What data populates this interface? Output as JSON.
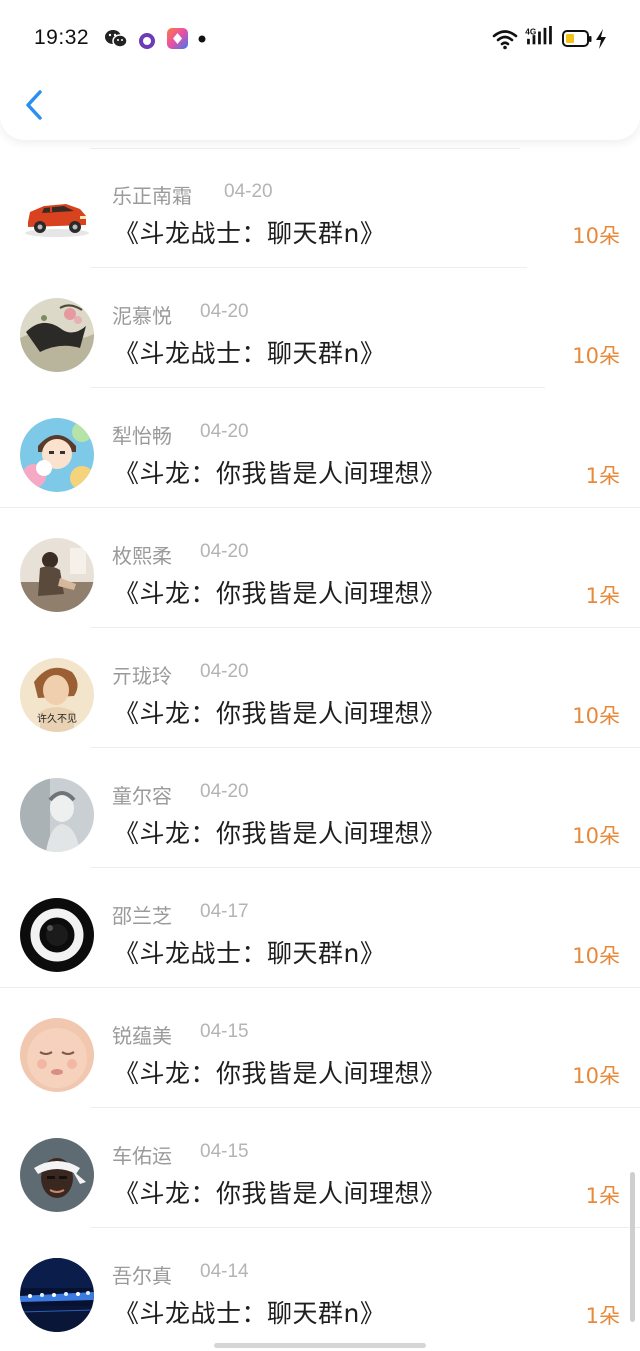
{
  "status_bar": {
    "time": "19:32",
    "network": "4G",
    "icons": [
      "wechat-icon",
      "dot-app-icon",
      "app-square-icon",
      "more-dot-icon",
      "wifi-icon",
      "signal-icon",
      "battery-icon",
      "charge-icon"
    ]
  },
  "nav": {
    "back_icon": "chevron-left-icon"
  },
  "colors": {
    "accent": "#e8883a",
    "back": "#2a8ff0",
    "name": "#9a9a9a",
    "date": "#b4b4b4",
    "message": "#1e1e1e"
  },
  "list": [
    {
      "name": "乐正南霜",
      "date": "04-20",
      "message": "《斗龙战士：聊天群n》",
      "count": "10朵",
      "avatar": "car-avatar"
    },
    {
      "name": "泥慕悦",
      "date": "04-20",
      "message": "《斗龙战士：聊天群n》",
      "count": "10朵",
      "avatar": "painting-avatar"
    },
    {
      "name": "犁怡畅",
      "date": "04-20",
      "message": "《斗龙：你我皆是人间理想》",
      "count": "1朵",
      "avatar": "cartoon-girl-avatar"
    },
    {
      "name": "枚熙柔",
      "date": "04-20",
      "message": "《斗龙：你我皆是人间理想》",
      "count": "1朵",
      "avatar": "sitting-person-avatar"
    },
    {
      "name": "亓珑玲",
      "date": "04-20",
      "message": "《斗龙：你我皆是人间理想》",
      "count": "10朵",
      "avatar": "portrait-avatar",
      "avatar_text": "许久不见"
    },
    {
      "name": "童尔容",
      "date": "04-20",
      "message": "《斗龙：你我皆是人间理想》",
      "count": "10朵",
      "avatar": "grey-photo-avatar"
    },
    {
      "name": "邵兰芝",
      "date": "04-17",
      "message": "《斗龙战士：聊天群n》",
      "count": "10朵",
      "avatar": "ring-avatar"
    },
    {
      "name": "锐蕴美",
      "date": "04-15",
      "message": "《斗龙：你我皆是人间理想》",
      "count": "10朵",
      "avatar": "baby-avatar"
    },
    {
      "name": "车佑运",
      "date": "04-15",
      "message": "《斗龙：你我皆是人间理想》",
      "count": "1朵",
      "avatar": "bandana-avatar"
    },
    {
      "name": "吾尔真",
      "date": "04-14",
      "message": "《斗龙战士：聊天群n》",
      "count": "1朵",
      "avatar": "night-lights-avatar"
    }
  ]
}
